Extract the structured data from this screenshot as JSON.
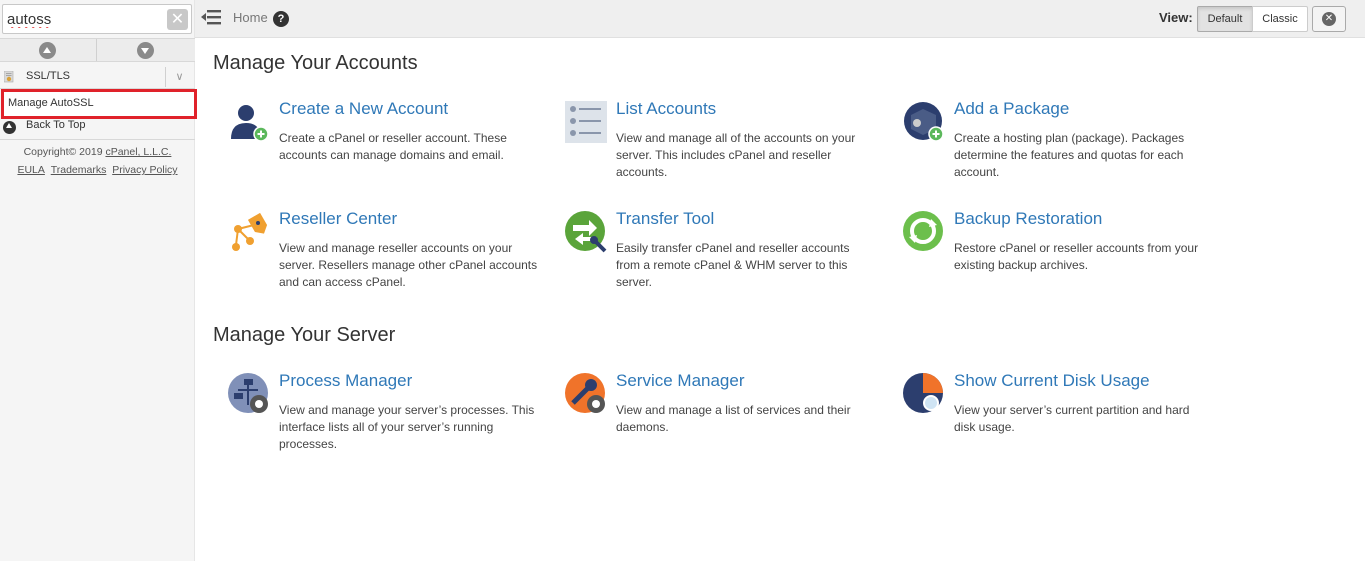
{
  "sidebar": {
    "search_value": "autoss",
    "clear_glyph": "✕",
    "category_label": "SSL/TLS",
    "category_chevron": "∨",
    "active_item": "Manage AutoSSL",
    "back_to_top": "Back To Top",
    "copyright": "Copyright© 2019",
    "company_link": "cPanel, L.L.C.",
    "eula": "EULA",
    "trademarks": "Trademarks",
    "privacy": "Privacy Policy"
  },
  "topbar": {
    "home": "Home",
    "help_glyph": "?",
    "view_label": "View:",
    "view_default": "Default",
    "view_classic": "Classic",
    "close_glyph": "✕"
  },
  "main": {
    "accounts_title": "Manage Your Accounts",
    "server_title": "Manage Your Server",
    "accounts": [
      {
        "title": "Create a New Account",
        "desc": "Create a cPanel or reseller account. These accounts can manage domains and email.",
        "icon": "user-add-icon"
      },
      {
        "title": "List Accounts",
        "desc": "View and manage all of the accounts on your server. This includes cPanel and reseller accounts.",
        "icon": "list-accounts-icon"
      },
      {
        "title": "Add a Package",
        "desc": "Create a hosting plan (package). Packages determine the features and quotas for each account.",
        "icon": "package-add-icon"
      },
      {
        "title": "Reseller Center",
        "desc": "View and manage reseller accounts on your server. Resellers manage other cPanel accounts and can access cPanel.",
        "icon": "reseller-network-icon"
      },
      {
        "title": "Transfer Tool",
        "desc": "Easily transfer cPanel and reseller accounts from a remote cPanel & WHM server to this server.",
        "icon": "transfer-tool-icon"
      },
      {
        "title": "Backup Restoration",
        "desc": "Restore cPanel or reseller accounts from your existing backup archives.",
        "icon": "backup-restore-icon"
      }
    ],
    "server": [
      {
        "title": "Process Manager",
        "desc": "View and manage your server’s processes. This interface lists all of your server’s running processes.",
        "icon": "process-manager-icon"
      },
      {
        "title": "Service Manager",
        "desc": "View and manage a list of services and their daemons.",
        "icon": "service-manager-icon"
      },
      {
        "title": "Show Current Disk Usage",
        "desc": "View your server’s current partition and hard disk usage.",
        "icon": "disk-usage-icon"
      }
    ]
  },
  "colors": {
    "link_blue": "#2f78b7",
    "highlight_red": "#e0222a",
    "icon_navy": "#2c3e6e",
    "icon_green": "#5cb85c",
    "icon_orange": "#f0a030"
  }
}
